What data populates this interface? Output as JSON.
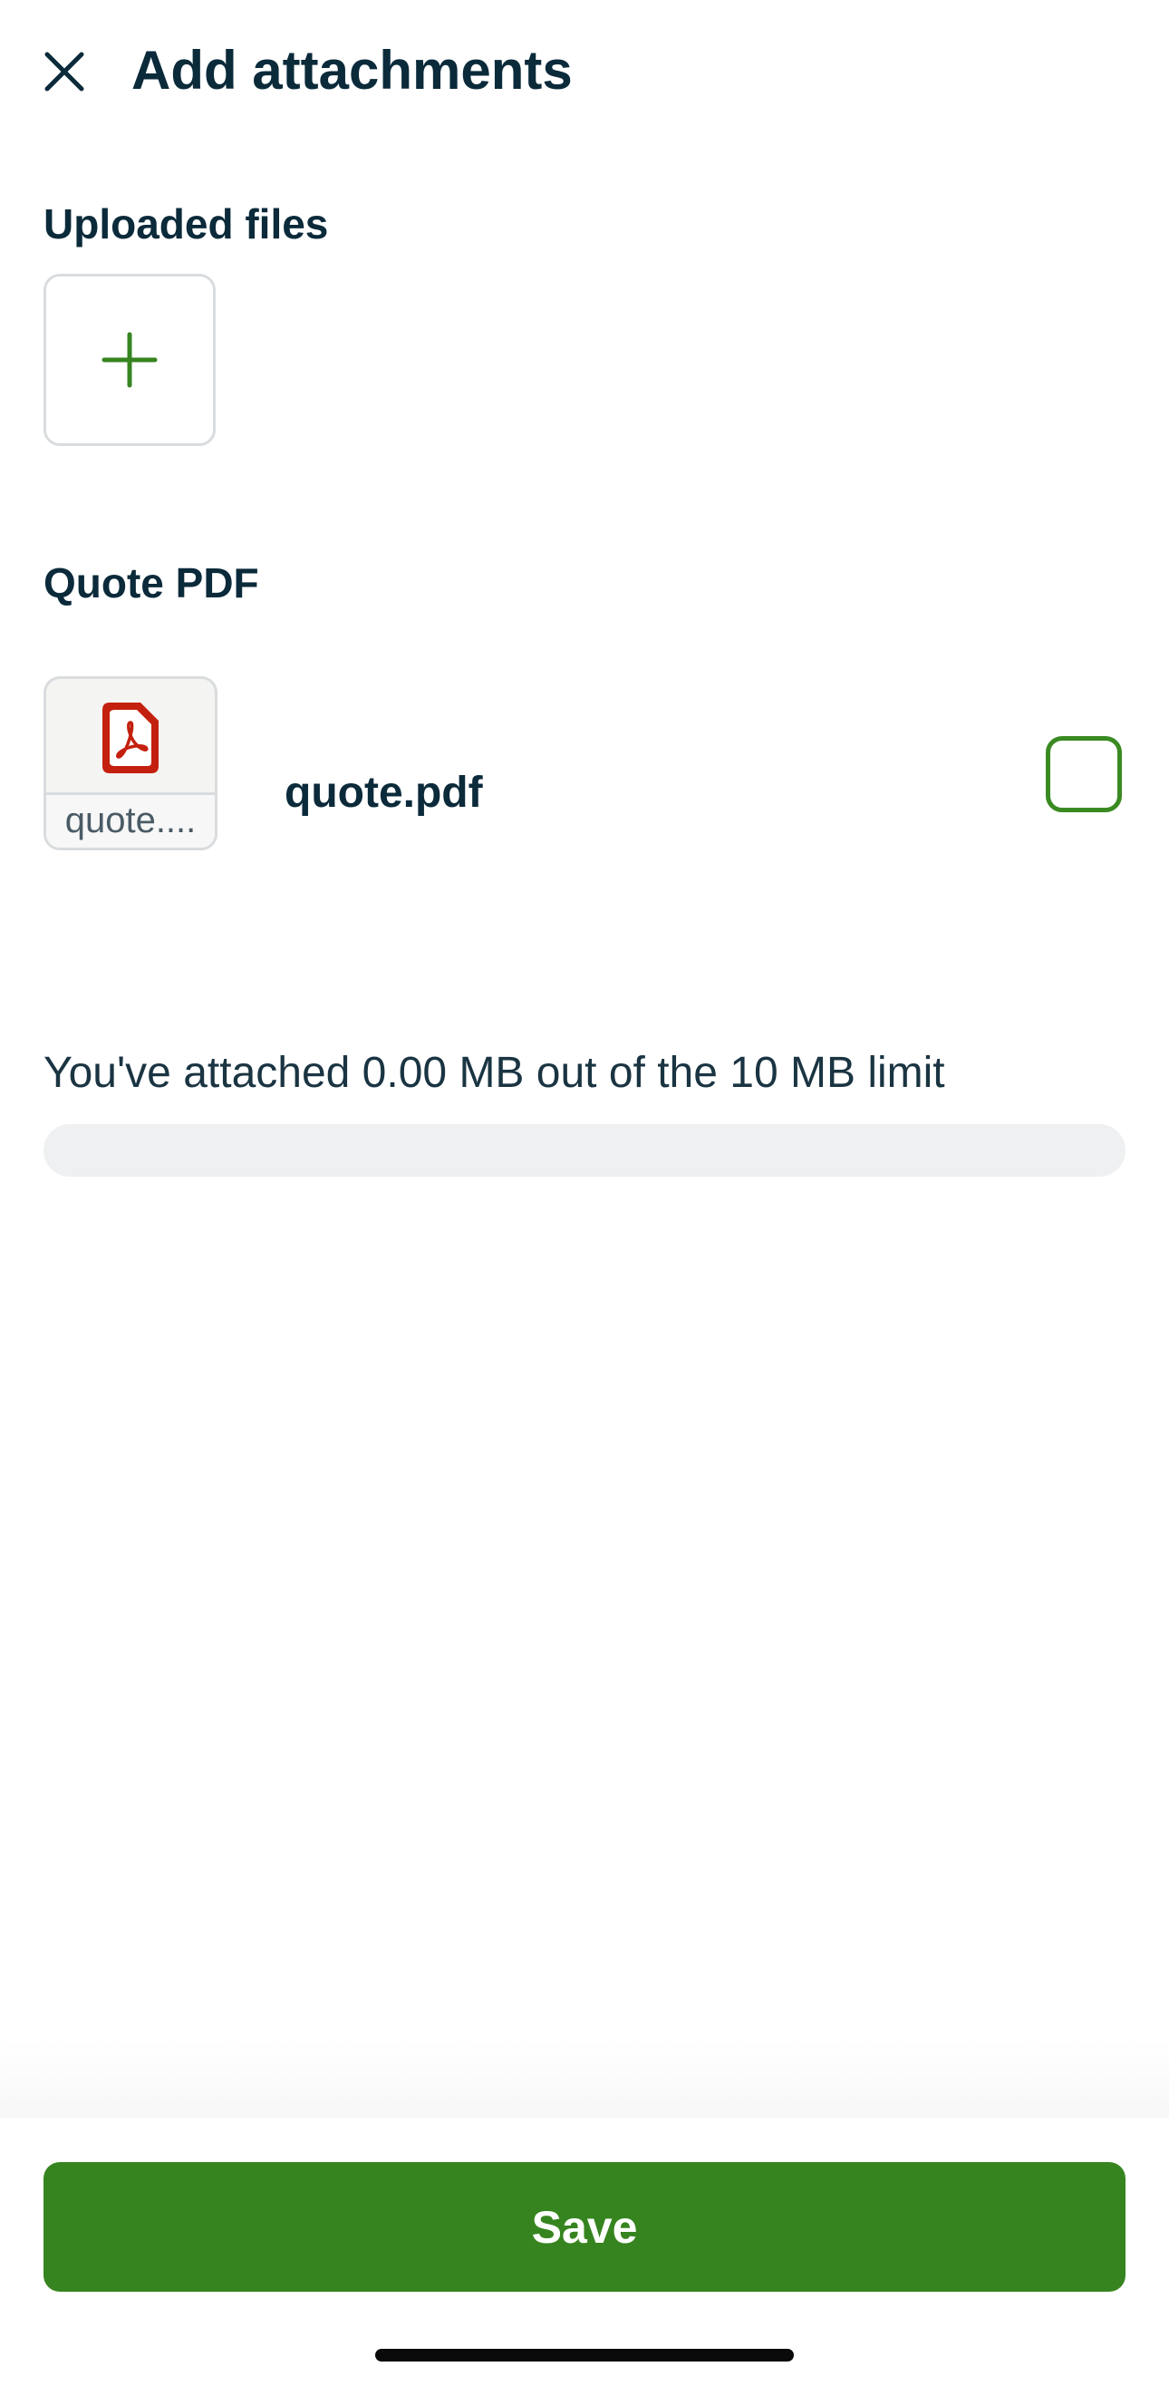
{
  "header": {
    "title": "Add attachments",
    "close_icon": "close-icon"
  },
  "uploaded_files": {
    "label": "Uploaded files",
    "add_icon": "plus-icon"
  },
  "quote_pdf": {
    "label": "Quote PDF",
    "file": {
      "thumbnail_caption": "quote....",
      "name": "quote.pdf",
      "icon": "pdf-file-icon",
      "selected": false
    }
  },
  "usage": {
    "text": "You've attached 0.00 MB out of the 10 MB limit",
    "used_mb": 0.0,
    "limit_mb": 10
  },
  "footer": {
    "save_label": "Save"
  },
  "colors": {
    "accent": "#36841f",
    "text": "#0b2a3a",
    "pdf_red": "#c4200f",
    "track": "#eef0f1"
  }
}
